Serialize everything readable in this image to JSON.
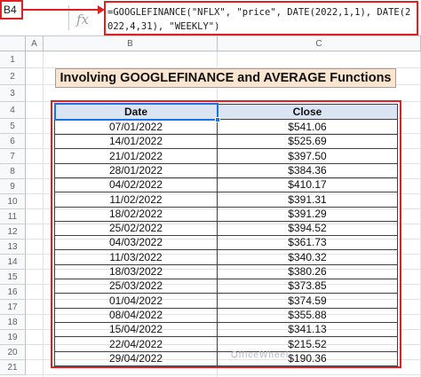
{
  "formula_bar": {
    "name_box": "B4",
    "fx": "fx",
    "formula": "=GOOGLEFINANCE(\"NFLX\", \"price\", DATE(2022,1,1), DATE(2022,4,31), \"WEEKLY\")"
  },
  "columns": [
    "A",
    "B",
    "C"
  ],
  "rows": [
    "1",
    "2",
    "3",
    "4",
    "5",
    "6",
    "7",
    "8",
    "9",
    "10",
    "11",
    "12",
    "13",
    "14",
    "15",
    "16",
    "17",
    "18",
    "19",
    "20",
    "21"
  ],
  "title": "Involving GOOGLEFINANCE and AVERAGE Functions",
  "table": {
    "headers": [
      "Date",
      "Close"
    ],
    "rows": [
      [
        "07/01/2022",
        "$541.06"
      ],
      [
        "14/01/2022",
        "$525.69"
      ],
      [
        "21/01/2022",
        "$397.50"
      ],
      [
        "28/01/2022",
        "$384.36"
      ],
      [
        "04/02/2022",
        "$410.17"
      ],
      [
        "11/02/2022",
        "$391.31"
      ],
      [
        "18/02/2022",
        "$391.29"
      ],
      [
        "25/02/2022",
        "$394.52"
      ],
      [
        "04/03/2022",
        "$361.73"
      ],
      [
        "11/03/2022",
        "$340.32"
      ],
      [
        "18/03/2022",
        "$380.26"
      ],
      [
        "25/03/2022",
        "$373.85"
      ],
      [
        "01/04/2022",
        "$374.59"
      ],
      [
        "08/04/2022",
        "$355.88"
      ],
      [
        "15/04/2022",
        "$341.13"
      ],
      [
        "22/04/2022",
        "$215.52"
      ],
      [
        "29/04/2022",
        "$190.36"
      ]
    ]
  },
  "watermark": "OfficeWheel",
  "colors": {
    "highlight": "#e02020",
    "header_fill": "#dbe4f3",
    "title_fill": "#fbe5cf",
    "selection": "#1a73e8"
  }
}
